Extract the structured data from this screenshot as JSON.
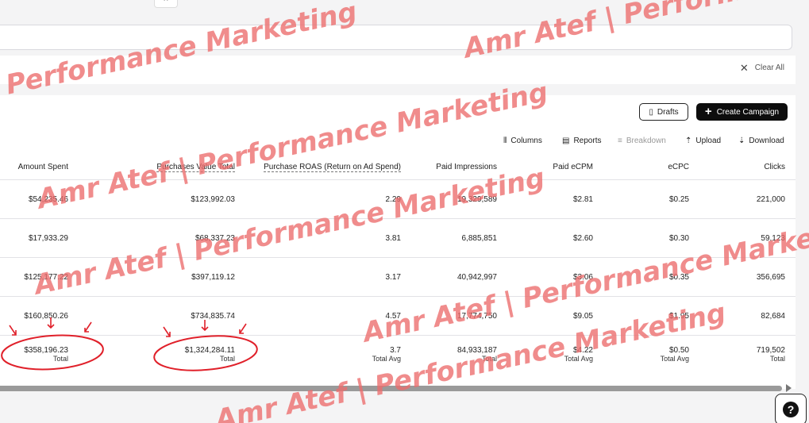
{
  "top": {
    "close_glyph": "×"
  },
  "filters": {
    "clear_all_label": "Clear All",
    "clear_icon": "close-icon"
  },
  "actions": {
    "drafts_label": "Drafts",
    "create_label": "Create Campaign"
  },
  "toolbar": {
    "columns_label": "Columns",
    "reports_label": "Reports",
    "breakdown_label": "Breakdown",
    "upload_label": "Upload",
    "download_label": "Download"
  },
  "table": {
    "headers": {
      "amount_spent": "Amount Spent",
      "purchases_value_total": "Purchases Value Total",
      "purchase_roas": "Purchase ROAS (Return on Ad Spend)",
      "paid_impressions": "Paid Impressions",
      "paid_ecpm": "Paid eCPM",
      "ecpc": "eCPC",
      "clicks": "Clicks"
    },
    "rows": [
      {
        "amount_spent": "$54,235.46",
        "purchases_value_total": "$123,992.03",
        "purchase_roas": "2.29",
        "paid_impressions": "19,329,589",
        "paid_ecpm": "$2.81",
        "ecpc": "$0.25",
        "clicks": "221,000"
      },
      {
        "amount_spent": "$17,933.29",
        "purchases_value_total": "$68,337.23",
        "purchase_roas": "3.81",
        "paid_impressions": "6,885,851",
        "paid_ecpm": "$2.60",
        "ecpc": "$0.30",
        "clicks": "59,123"
      },
      {
        "amount_spent": "$125,177.22",
        "purchases_value_total": "$397,119.12",
        "purchase_roas": "3.17",
        "paid_impressions": "40,942,997",
        "paid_ecpm": "$3.06",
        "ecpc": "$0.35",
        "clicks": "356,695"
      },
      {
        "amount_spent": "$160,850.26",
        "purchases_value_total": "$734,835.74",
        "purchase_roas": "4.57",
        "paid_impressions": "17,774,750",
        "paid_ecpm": "$9.05",
        "ecpc": "$1.95",
        "clicks": "82,684"
      }
    ],
    "totals": {
      "amount_spent": "$358,196.23",
      "amount_spent_sub": "Total",
      "purchases_value_total": "$1,324,284.11",
      "purchases_value_total_sub": "Total",
      "purchase_roas": "3.7",
      "purchase_roas_sub": "Total Avg",
      "paid_impressions": "84,933,187",
      "paid_impressions_sub": "Total",
      "paid_ecpm": "$4.22",
      "paid_ecpm_sub": "Total Avg",
      "ecpc": "$0.50",
      "ecpc_sub": "Total Avg",
      "clicks": "719,502",
      "clicks_sub": "Total"
    }
  },
  "watermarks": {
    "w1": "Performance Marketing",
    "w2": "Amr Atef | Performance",
    "w3": "Amr Atef | Performance Marketing",
    "w4": "Amr Atef | Performance Marketing",
    "w5": "Amr Atef | Performance Marke",
    "w6": "Amr Atef | Performance Marketing"
  },
  "colors": {
    "watermark": "#ec6c6c",
    "annotation": "#e0202a",
    "primary_button": "#0d0d0d"
  },
  "help": {
    "glyph": "?"
  }
}
